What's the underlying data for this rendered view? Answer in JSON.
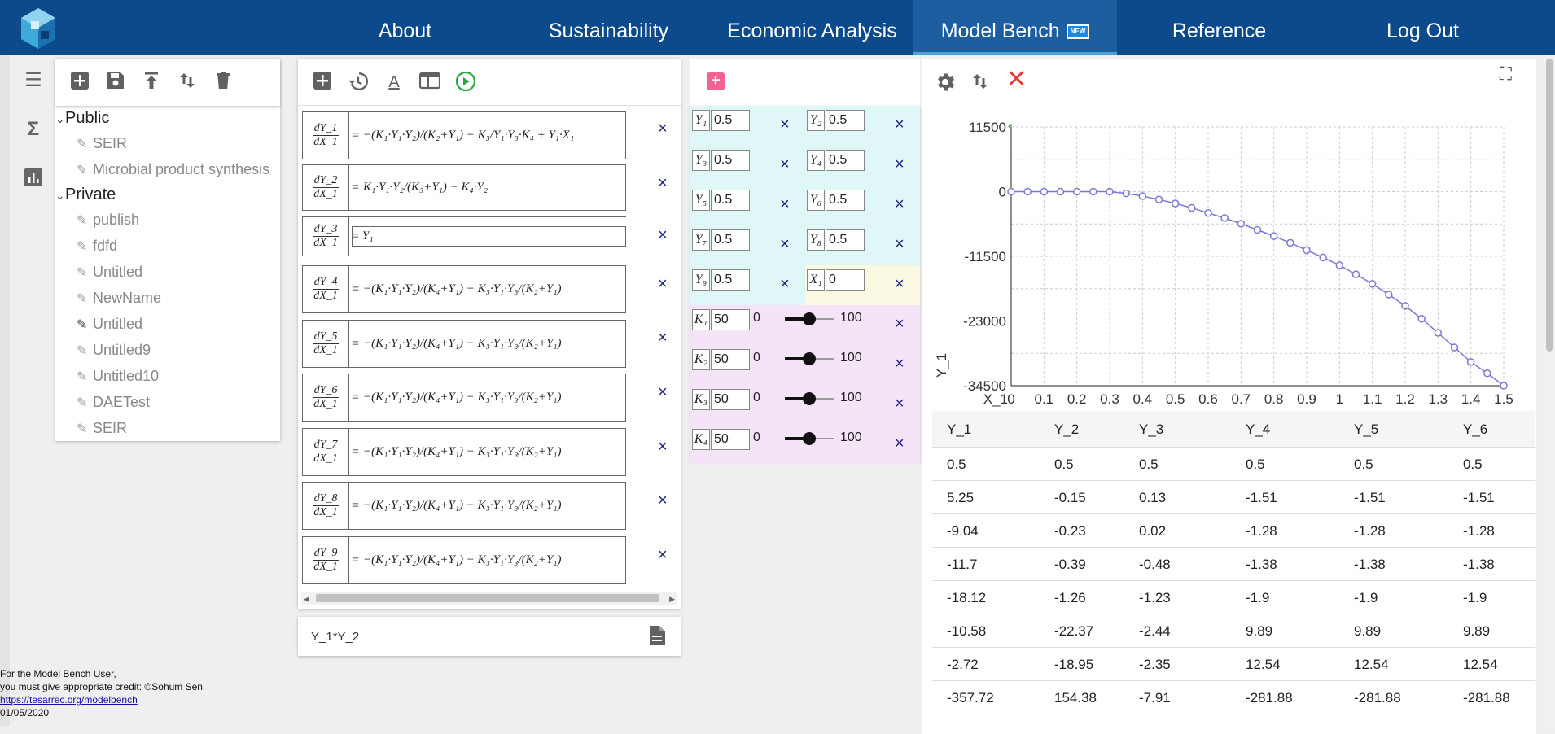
{
  "nav": {
    "items": [
      "About",
      "Sustainability",
      "Economic Analysis",
      "Model Bench",
      "Reference",
      "Log Out"
    ],
    "new_badge": "NEW",
    "active": "Model Bench"
  },
  "sidebar": {
    "icons": [
      "menu-icon",
      "sigma-icon",
      "bar-chart-icon"
    ]
  },
  "models_panel": {
    "toolbar": [
      "add-icon",
      "save-icon",
      "upload-icon",
      "sort-icon",
      "delete-icon"
    ],
    "groups": [
      {
        "label": "Public",
        "items": [
          "SEIR",
          "Microbial product synthesis"
        ]
      },
      {
        "label": "Private",
        "items": [
          "publish",
          "fdfd",
          "Untitled",
          "NewName",
          "Untitled",
          "Untitled9",
          "Untitled10",
          "DAETest",
          "SEIR"
        ]
      }
    ],
    "active_item": "Untitled"
  },
  "equations_panel": {
    "toolbar": [
      "add-icon",
      "history-icon",
      "text-format-icon",
      "table-icon",
      "play-icon"
    ],
    "equations": [
      {
        "num": "dY_1",
        "den": "dX_1",
        "rhs": "−(K₁·Y₁·Y₂)/(K₂+Y₁) − K₃/Y₁·Y₃·K₄ + Y₁·X₁"
      },
      {
        "num": "dY_2",
        "den": "dX_1",
        "rhs": "K₁·Y₁·Y₂/(K₃+Y₁) − K₄·Y₂"
      },
      {
        "num": "dY_3",
        "den": "dX_1",
        "rhs": "Y₁"
      },
      {
        "num": "dY_4",
        "den": "dX_1",
        "rhs": "−(K₁·Y₁·Y₂)/(K₄+Y₁) − K₃·Y₁·Y₃/(K₂+Y₁)"
      },
      {
        "num": "dY_5",
        "den": "dX_1",
        "rhs": "−(K₁·Y₁·Y₂)/(K₄+Y₁) − K₃·Y₁·Y₃/(K₂+Y₁)"
      },
      {
        "num": "dY_6",
        "den": "dX_1",
        "rhs": "−(K₁·Y₁·Y₂)/(K₄+Y₁) − K₃·Y₁·Y₃/(K₂+Y₁)"
      },
      {
        "num": "dY_7",
        "den": "dX_1",
        "rhs": "−(K₁·Y₁·Y₂)/(K₄+Y₁) − K₃·Y₁·Y₃/(K₂+Y₁)"
      },
      {
        "num": "dY_8",
        "den": "dX_1",
        "rhs": "−(K₁·Y₁·Y₂)/(K₄+Y₁) − K₃·Y₁·Y₃/(K₂+Y₁)"
      },
      {
        "num": "dY_9",
        "den": "dX_1",
        "rhs": "−(K₁·Y₁·Y₂)/(K₄+Y₁) − K₃·Y₁·Y₃/(K₂+Y₁)"
      }
    ],
    "close_symbol": "×",
    "expression": "Y_1*Y_2"
  },
  "params_panel": {
    "vars": [
      {
        "name": "Y₁",
        "value": "0.5"
      },
      {
        "name": "Y₂",
        "value": "0.5"
      },
      {
        "name": "Y₃",
        "value": "0.5"
      },
      {
        "name": "Y₄",
        "value": "0.5"
      },
      {
        "name": "Y₅",
        "value": "0.5"
      },
      {
        "name": "Y₆",
        "value": "0.5"
      },
      {
        "name": "Y₇",
        "value": "0.5"
      },
      {
        "name": "Y₈",
        "value": "0.5"
      },
      {
        "name": "Y₉",
        "value": "0.5"
      },
      {
        "name": "X₁",
        "value": "0"
      }
    ],
    "constants": [
      {
        "name": "K₁",
        "value": "50",
        "min": "0",
        "max": "100",
        "level": 0.5
      },
      {
        "name": "K₂",
        "value": "50",
        "min": "0",
        "max": "100",
        "level": 0.5
      },
      {
        "name": "K₃",
        "value": "50",
        "min": "0",
        "max": "100",
        "level": 0.5
      },
      {
        "name": "K₄",
        "value": "50",
        "min": "0",
        "max": "100",
        "level": 0.5
      }
    ],
    "colors": {
      "var_bg": "#e0f7f7",
      "x_bg": "#fbf8e1",
      "const_bg": "#f5e3f7",
      "add": "#f06292"
    }
  },
  "chart_data": {
    "type": "line",
    "xlabel": "X_1",
    "ylabel": "Y_1",
    "x": [
      0,
      0.05,
      0.1,
      0.15,
      0.2,
      0.25,
      0.3,
      0.35,
      0.4,
      0.45,
      0.5,
      0.55,
      0.6,
      0.65,
      0.7,
      0.75,
      0.8,
      0.85,
      0.9,
      0.95,
      1.0,
      1.05,
      1.1,
      1.15,
      1.2,
      1.25,
      1.3,
      1.35,
      1.4,
      1.45,
      1.5
    ],
    "y": [
      0,
      0,
      0,
      0,
      0,
      0,
      0,
      -300,
      -800,
      -1400,
      -2100,
      -2900,
      -3800,
      -4700,
      -5700,
      -6800,
      -7900,
      -9100,
      -10400,
      -11700,
      -13100,
      -14700,
      -16400,
      -18300,
      -20300,
      -22600,
      -25100,
      -27700,
      -30300,
      -32300,
      -34500
    ],
    "xticks": [
      "0",
      "0.1",
      "0.2",
      "0.3",
      "0.4",
      "0.5",
      "0.6",
      "0.7",
      "0.8",
      "0.9",
      "1",
      "1.1",
      "1.2",
      "1.3",
      "1.4",
      "1.5"
    ],
    "yticks": [
      "11500",
      "0",
      "-11500",
      "-23000",
      "-34500"
    ],
    "xlim": [
      0,
      1.5
    ],
    "ylim": [
      -34500,
      11500
    ],
    "grid": true,
    "color": "#7b78d6"
  },
  "chart_toolbar": [
    "settings-icon",
    "sort-icon",
    "close-icon",
    "fullscreen-icon"
  ],
  "table": {
    "headers": [
      "Y_1",
      "Y_2",
      "Y_3",
      "Y_4",
      "Y_5",
      "Y_6"
    ],
    "rows": [
      [
        "0.5",
        "0.5",
        "0.5",
        "0.5",
        "0.5",
        "0.5"
      ],
      [
        "5.25",
        "-0.15",
        "0.13",
        "-1.51",
        "-1.51",
        "-1.51"
      ],
      [
        "-9.04",
        "-0.23",
        "0.02",
        "-1.28",
        "-1.28",
        "-1.28"
      ],
      [
        "-11.7",
        "-0.39",
        "-0.48",
        "-1.38",
        "-1.38",
        "-1.38"
      ],
      [
        "-18.12",
        "-1.26",
        "-1.23",
        "-1.9",
        "-1.9",
        "-1.9"
      ],
      [
        "-10.58",
        "-22.37",
        "-2.44",
        "9.89",
        "9.89",
        "9.89"
      ],
      [
        "-2.72",
        "-18.95",
        "-2.35",
        "12.54",
        "12.54",
        "12.54"
      ],
      [
        "-357.72",
        "154.38",
        "-7.91",
        "-281.88",
        "-281.88",
        "-281.88"
      ]
    ]
  },
  "credit": {
    "line1": "For the Model Bench User,",
    "line2": "you must give appropriate credit: ©Sohum Sen",
    "link": "https://tesarrec.org/modelbench",
    "date": "01/05/2020"
  }
}
